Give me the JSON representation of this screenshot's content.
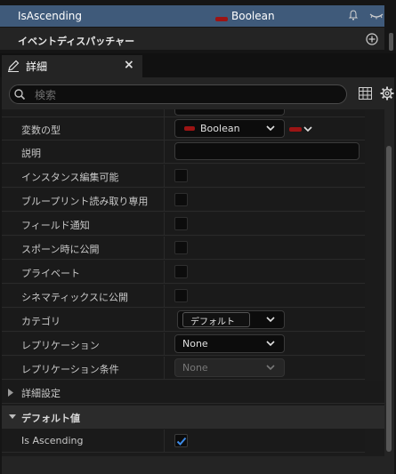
{
  "top_variable": {
    "name": "IsAscending",
    "type": "Boolean",
    "type_color": "#9c1414"
  },
  "dispatcher": {
    "label": "イベントディスパッチャー"
  },
  "tab": {
    "title": "詳細",
    "close": "×"
  },
  "search": {
    "placeholder": "検索"
  },
  "rows": {
    "var_type": {
      "label": "変数の型",
      "value": "Boolean"
    },
    "description": {
      "label": "説明"
    },
    "instance_editable": {
      "label": "インスタンス編集可能"
    },
    "bp_readonly": {
      "label": "ブループリント読み取り専用"
    },
    "field_notify": {
      "label": "フィールド通知"
    },
    "expose_spawn": {
      "label": "スポーン時に公開"
    },
    "private": {
      "label": "プライベート"
    },
    "expose_cinematics": {
      "label": "シネマティックスに公開"
    },
    "category": {
      "label": "カテゴリ",
      "value": "デフォルト"
    },
    "replication": {
      "label": "レプリケーション",
      "value": "None"
    },
    "replication_condition": {
      "label": "レプリケーション条件",
      "value": "None"
    }
  },
  "advanced": {
    "label": "詳細設定"
  },
  "default_value": {
    "label": "デフォルト値",
    "field": "Is Ascending",
    "checked": true
  },
  "colors": {
    "accent_blue": "#3f5a7a",
    "checkbox_check": "#3d8be8"
  }
}
